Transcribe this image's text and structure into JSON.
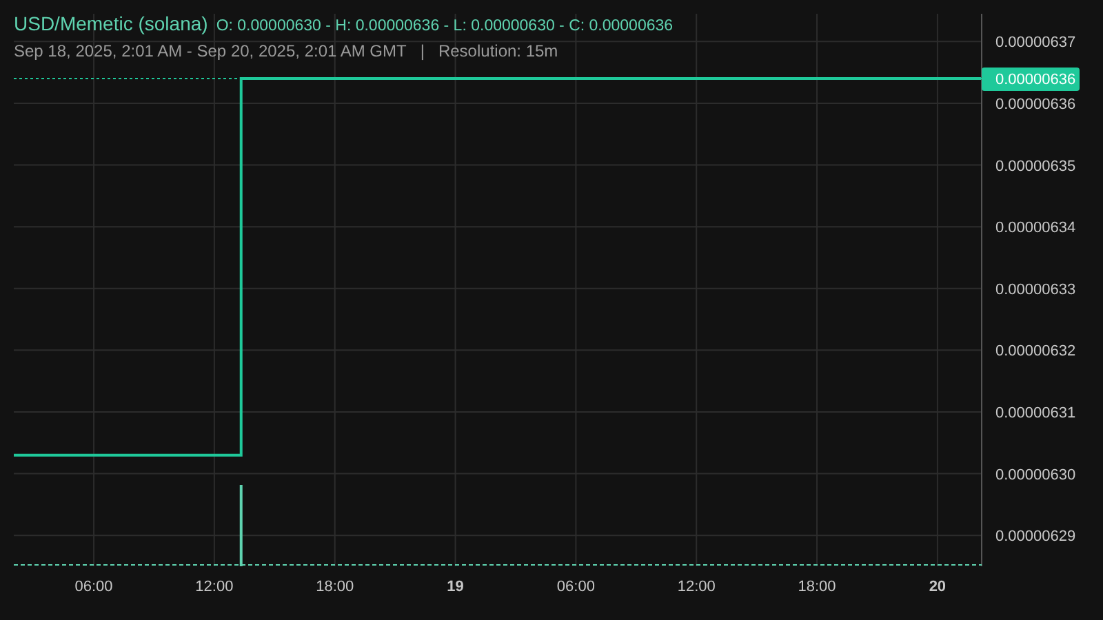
{
  "header": {
    "title": "USD/Memetic (solana)",
    "ohlc": "O: 0.00000630 - H: 0.00000636 - L: 0.00000630 - C: 0.00000636",
    "range": "Sep 18, 2025, 2:01 AM - Sep 20, 2025, 2:01 AM GMT",
    "separator": "|",
    "resolution": "Resolution: 15m"
  },
  "chart": {
    "price_badge": "0.00000636",
    "chart_data": {
      "type": "line",
      "grid": true,
      "x": [
        "2025-09-18T02:01Z",
        "2025-09-18T13:20Z",
        "2025-09-18T13:20Z",
        "2025-09-20T02:12Z"
      ],
      "series": [
        {
          "color": "#1fc99a",
          "values": [
            6.303e-06,
            6.303e-06,
            6.364e-06,
            6.364e-06
          ]
        }
      ],
      "xlim": [
        "2025-09-18T02:01Z",
        "2025-09-20T02:12Z"
      ],
      "ylim": [
        6.285e-06,
        6.3745e-06
      ],
      "xticks": [
        {
          "value": "2025-09-18T06:00Z",
          "label": "06:00"
        },
        {
          "value": "2025-09-18T12:00Z",
          "label": "12:00"
        },
        {
          "value": "2025-09-18T18:00Z",
          "label": "18:00"
        },
        {
          "value": "2025-09-19T00:00Z",
          "label": "19"
        },
        {
          "value": "2025-09-19T06:00Z",
          "label": "06:00"
        },
        {
          "value": "2025-09-19T12:00Z",
          "label": "12:00"
        },
        {
          "value": "2025-09-19T18:00Z",
          "label": "18:00"
        },
        {
          "value": "2025-09-20T00:00Z",
          "label": "20"
        }
      ],
      "yticks": [
        {
          "value": 6.37e-06,
          "label": "0.00000637"
        },
        {
          "value": 6.36e-06,
          "label": "0.00000636"
        },
        {
          "value": 6.35e-06,
          "label": "0.00000635"
        },
        {
          "value": 6.34e-06,
          "label": "0.00000634"
        },
        {
          "value": 6.33e-06,
          "label": "0.00000633"
        },
        {
          "value": 6.32e-06,
          "label": "0.00000632"
        },
        {
          "value": 6.31e-06,
          "label": "0.00000631"
        },
        {
          "value": 6.3e-06,
          "label": "0.00000630"
        },
        {
          "value": 6.29e-06,
          "label": "0.00000629"
        }
      ]
    }
  }
}
